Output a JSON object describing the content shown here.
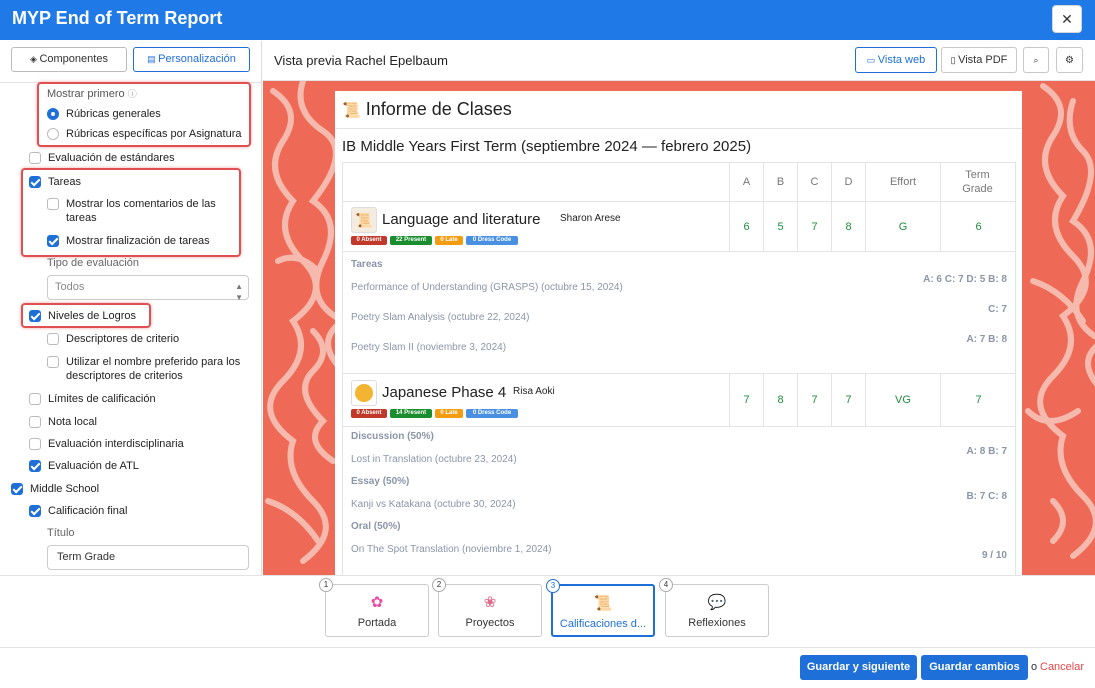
{
  "window": {
    "title": "MYP End of Term Report",
    "close": "✕"
  },
  "left_panel": {
    "tabs": [
      "Componentes",
      "Personalización"
    ],
    "show_first": {
      "label": "Mostrar primero",
      "options": [
        "Rúbricas generales",
        "Rúbricas específicas por Asignatura"
      ],
      "selected": 0
    },
    "items": {
      "standards": "Evaluación de estándares",
      "tasks": "Tareas",
      "task_comments": "Mostrar los comentarios de las tareas",
      "task_completion": "Mostrar finalización de tareas",
      "eval_type_label": "Tipo de evaluación",
      "eval_type_value": "Todos",
      "achievement_levels": "Niveles de Logros",
      "criterion_descriptors": "Descriptores de criterio",
      "preferred_name": "Utilizar el nombre preferido para los descriptores de criterios",
      "grade_limits": "Límites de calificación",
      "local_grade": "Nota local",
      "interdisciplinary": "Evaluación interdisciplinaria",
      "atl": "Evaluación de ATL",
      "middle_school": "Middle School",
      "final_grade": "Calificación final",
      "title_label": "Título",
      "title_value": "Term Grade"
    }
  },
  "preview": {
    "title": "Vista previa Rachel Epelbaum",
    "buttons": {
      "web": "Vista web",
      "pdf": "Vista PDF"
    },
    "report": {
      "heading": "Informe de Clases",
      "term": "IB Middle Years First Term (septiembre 2024 — febrero 2025)",
      "columns": [
        "A",
        "B",
        "C",
        "D",
        "Effort",
        "Term Grade"
      ],
      "subjects": [
        {
          "name": "Language and literature",
          "teacher": "Sharon Arese",
          "badges": [
            "0 Absent",
            "22 Present",
            "0 Late",
            "0 Dress Code"
          ],
          "grades": [
            "6",
            "5",
            "7",
            "8",
            "G",
            "6"
          ],
          "section": "Tareas",
          "tasks": [
            {
              "name": "Performance of Understanding (GRASPS) (octubre 15, 2024)",
              "score": "A: 6 C: 7 D: 5 B: 8"
            },
            {
              "name": "Poetry Slam Analysis (octubre 22, 2024)",
              "score": "C: 7"
            },
            {
              "name": "Poetry Slam II (noviembre 3, 2024)",
              "score": "A: 7 B: 8"
            }
          ]
        },
        {
          "name": "Japanese Phase 4",
          "teacher": "Risa Aoki",
          "badges": [
            "0 Absent",
            "14 Present",
            "0 Late",
            "0 Dress Code"
          ],
          "grades": [
            "7",
            "8",
            "7",
            "7",
            "VG",
            "7"
          ],
          "groups": [
            {
              "name": "Discussion (50%)",
              "task": "Lost in Translation (octubre 23, 2024)",
              "score": "A: 8 B: 7"
            },
            {
              "name": "Essay (50%)",
              "task": "Kanji vs Katakana (octubre 30, 2024)",
              "score": "B: 7 C: 8"
            },
            {
              "name": "Oral (50%)",
              "task": "On The Spot Translation (noviembre 1, 2024)",
              "score": "9 / 10"
            }
          ]
        }
      ]
    }
  },
  "steps": [
    {
      "num": "1",
      "label": "Portada"
    },
    {
      "num": "2",
      "label": "Proyectos"
    },
    {
      "num": "3",
      "label": "Calificaciones d..."
    },
    {
      "num": "4",
      "label": "Reflexiones"
    }
  ],
  "footer": {
    "save_next": "Guardar y siguiente",
    "save": "Guardar cambios",
    "or": "o",
    "cancel": "Cancelar"
  },
  "colors": {
    "primary": "#1f7ae8",
    "accent": "#1f6fd8",
    "highlight": "#e05050",
    "background_pattern": "#ee6a57",
    "grade_green": "#1c8d3c",
    "badge_absent": "#c0392b",
    "badge_present": "#1a8d2f",
    "badge_late": "#f39c12",
    "badge_dress": "#4a90e2"
  }
}
